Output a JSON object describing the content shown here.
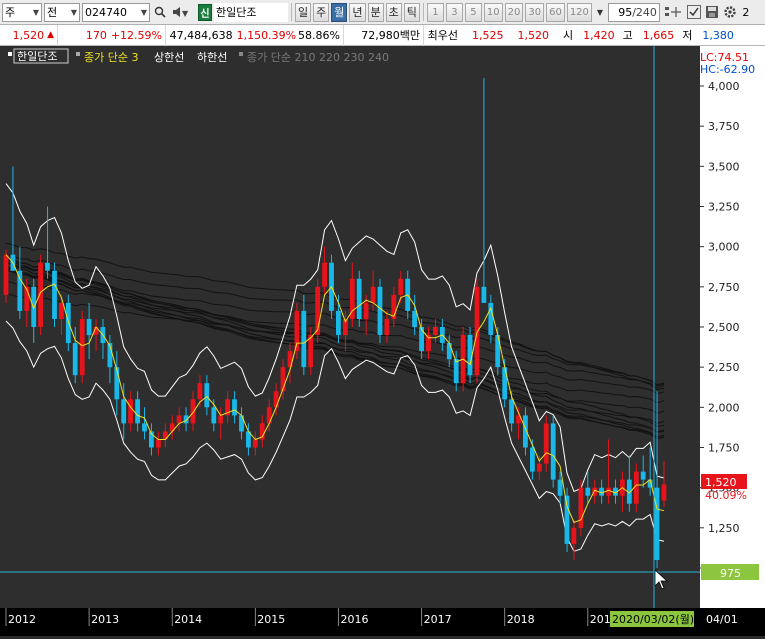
{
  "toolbar": {
    "period_type": "주",
    "market": "전",
    "code": "024740",
    "new_badge": "신",
    "stock_name": "한일단조",
    "periods": [
      "일",
      "주",
      "월",
      "년",
      "분",
      "초",
      "틱"
    ],
    "active_period": "월",
    "minute_nums": [
      "1",
      "3",
      "5",
      "10",
      "20",
      "30",
      "60",
      "120"
    ],
    "count": "95",
    "total": "/240",
    "extra": "2"
  },
  "quote": {
    "price": "1,520",
    "change_arrow": "▲",
    "change": "170",
    "change_pct": "+12.59%",
    "volume": "47,484,638",
    "volume_pct": "1,150.39%",
    "turnover": "58.86%",
    "amount": "72,980백만",
    "best_label": "최우선",
    "ask": "1,525",
    "bid": "1,520",
    "open_label": "시",
    "open": "1,420",
    "high_label": "고",
    "high": "1,665",
    "low_label": "저",
    "low": "1,380"
  },
  "legend": {
    "name": "한일단조",
    "ma_label": "종가 단순 3",
    "upper_label": "상한선",
    "lower_label": "하한선",
    "ma_group_label": "종가 단순 210 220 230 240"
  },
  "price_axis": {
    "lc": "LC:74.51",
    "hc": "HC:-62.90",
    "ticks": [
      "4,000",
      "3,750",
      "3,500",
      "3,250",
      "3,000",
      "2,750",
      "2,500",
      "2,250",
      "2,000",
      "1,750",
      "1,500",
      "1,250",
      "1,000"
    ],
    "current_price": "1,520",
    "current_pct": "40.09%",
    "crosshair_price": "975"
  },
  "time_axis": {
    "years": [
      "2012",
      "2013",
      "2014",
      "2015",
      "2016",
      "2017",
      "2018",
      "2019"
    ],
    "cursor_date": "2020/03/02(월)",
    "right_label": "04/01"
  },
  "colors": {
    "up": "#e8141c",
    "down": "#1ab8e8",
    "ma3": "#f0e020",
    "envelope": "#ffffff",
    "crosshair": "#2ab4d8",
    "badge_green": "#8cc63e"
  },
  "chart_data": {
    "type": "candlestick",
    "interval": "monthly",
    "x_start": "2012-01",
    "x_end": "2020-03",
    "ylim": [
      975,
      4000
    ],
    "ohlc": [
      [
        2700,
        2980,
        2650,
        2950
      ],
      [
        2950,
        3500,
        2900,
        2850
      ],
      [
        2850,
        3000,
        2550,
        2600
      ],
      [
        2600,
        2800,
        2500,
        2750
      ],
      [
        2750,
        2800,
        2400,
        2500
      ],
      [
        2500,
        2950,
        2450,
        2900
      ],
      [
        2900,
        3250,
        2800,
        2850
      ],
      [
        2850,
        2900,
        2500,
        2550
      ],
      [
        2550,
        2700,
        2450,
        2650
      ],
      [
        2650,
        2700,
        2350,
        2400
      ],
      [
        2400,
        2500,
        2150,
        2200
      ],
      [
        2200,
        2600,
        2150,
        2550
      ],
      [
        2550,
        2650,
        2300,
        2450
      ],
      [
        2450,
        2550,
        2350,
        2500
      ],
      [
        2500,
        2550,
        2300,
        2400
      ],
      [
        2400,
        2450,
        2150,
        2250
      ],
      [
        2250,
        2350,
        1950,
        2050
      ],
      [
        2050,
        2150,
        1800,
        1900
      ],
      [
        1900,
        2100,
        1850,
        2050
      ],
      [
        2050,
        2100,
        1850,
        1900
      ],
      [
        1900,
        2000,
        1800,
        1850
      ],
      [
        1850,
        1900,
        1700,
        1750
      ],
      [
        1750,
        1850,
        1700,
        1800
      ],
      [
        1800,
        1900,
        1750,
        1850
      ],
      [
        1850,
        1950,
        1800,
        1900
      ],
      [
        1900,
        2000,
        1850,
        1950
      ],
      [
        1950,
        2000,
        1850,
        1900
      ],
      [
        1900,
        2100,
        1850,
        2050
      ],
      [
        2050,
        2200,
        2000,
        2150
      ],
      [
        2150,
        2200,
        1950,
        2000
      ],
      [
        2000,
        2050,
        1850,
        1900
      ],
      [
        1900,
        2000,
        1800,
        1950
      ],
      [
        1950,
        2100,
        1900,
        2050
      ],
      [
        2050,
        2100,
        1900,
        1950
      ],
      [
        1950,
        2000,
        1800,
        1850
      ],
      [
        1850,
        1900,
        1700,
        1750
      ],
      [
        1750,
        1850,
        1700,
        1800
      ],
      [
        1800,
        1950,
        1750,
        1900
      ],
      [
        1900,
        2050,
        1850,
        2000
      ],
      [
        2000,
        2150,
        1950,
        2100
      ],
      [
        2100,
        2300,
        2050,
        2250
      ],
      [
        2250,
        2400,
        2150,
        2350
      ],
      [
        2350,
        2650,
        2300,
        2600
      ],
      [
        2600,
        2700,
        2200,
        2250
      ],
      [
        2250,
        2500,
        2200,
        2450
      ],
      [
        2450,
        2800,
        2400,
        2750
      ],
      [
        2750,
        3000,
        2700,
        2900
      ],
      [
        2900,
        2950,
        2550,
        2600
      ],
      [
        2600,
        2700,
        2400,
        2450
      ],
      [
        2450,
        2600,
        2350,
        2550
      ],
      [
        2550,
        2900,
        2500,
        2800
      ],
      [
        2800,
        2850,
        2500,
        2550
      ],
      [
        2550,
        2700,
        2450,
        2650
      ],
      [
        2650,
        2850,
        2600,
        2750
      ],
      [
        2750,
        2800,
        2400,
        2450
      ],
      [
        2450,
        2600,
        2400,
        2550
      ],
      [
        2550,
        2750,
        2500,
        2700
      ],
      [
        2700,
        2850,
        2650,
        2800
      ],
      [
        2800,
        2850,
        2550,
        2600
      ],
      [
        2600,
        2700,
        2450,
        2500
      ],
      [
        2500,
        2550,
        2300,
        2350
      ],
      [
        2350,
        2500,
        2300,
        2450
      ],
      [
        2450,
        2550,
        2400,
        2500
      ],
      [
        2500,
        2550,
        2350,
        2400
      ],
      [
        2400,
        2450,
        2250,
        2300
      ],
      [
        2300,
        2350,
        2100,
        2150
      ],
      [
        2150,
        2500,
        2100,
        2450
      ],
      [
        2450,
        2500,
        2150,
        2200
      ],
      [
        2200,
        2800,
        2150,
        2750
      ],
      [
        2750,
        4050,
        2700,
        2650
      ],
      [
        2650,
        2700,
        2400,
        2450
      ],
      [
        2450,
        2500,
        2200,
        2250
      ],
      [
        2250,
        2300,
        2000,
        2050
      ],
      [
        2050,
        2100,
        1850,
        1900
      ],
      [
        1900,
        2000,
        1800,
        1950
      ],
      [
        1950,
        2000,
        1700,
        1750
      ],
      [
        1750,
        1800,
        1550,
        1600
      ],
      [
        1600,
        1700,
        1550,
        1650
      ],
      [
        1650,
        1950,
        1600,
        1900
      ],
      [
        1900,
        1950,
        1500,
        1550
      ],
      [
        1550,
        1600,
        1400,
        1450
      ],
      [
        1450,
        1500,
        1100,
        1150
      ],
      [
        1150,
        1300,
        1050,
        1250
      ],
      [
        1250,
        1550,
        1200,
        1500
      ],
      [
        1500,
        1600,
        1400,
        1450
      ],
      [
        1450,
        1550,
        1400,
        1500
      ],
      [
        1500,
        1550,
        1400,
        1450
      ],
      [
        1450,
        1800,
        1400,
        1500
      ],
      [
        1500,
        1550,
        1400,
        1450
      ],
      [
        1450,
        1600,
        1350,
        1550
      ],
      [
        1550,
        1700,
        1350,
        1400
      ],
      [
        1400,
        1650,
        1350,
        1600
      ],
      [
        1600,
        1700,
        1500,
        1550
      ],
      [
        1550,
        1750,
        1450,
        1500
      ],
      [
        1500,
        2100,
        1000,
        1050
      ],
      [
        1420,
        1665,
        1380,
        1520
      ]
    ]
  }
}
